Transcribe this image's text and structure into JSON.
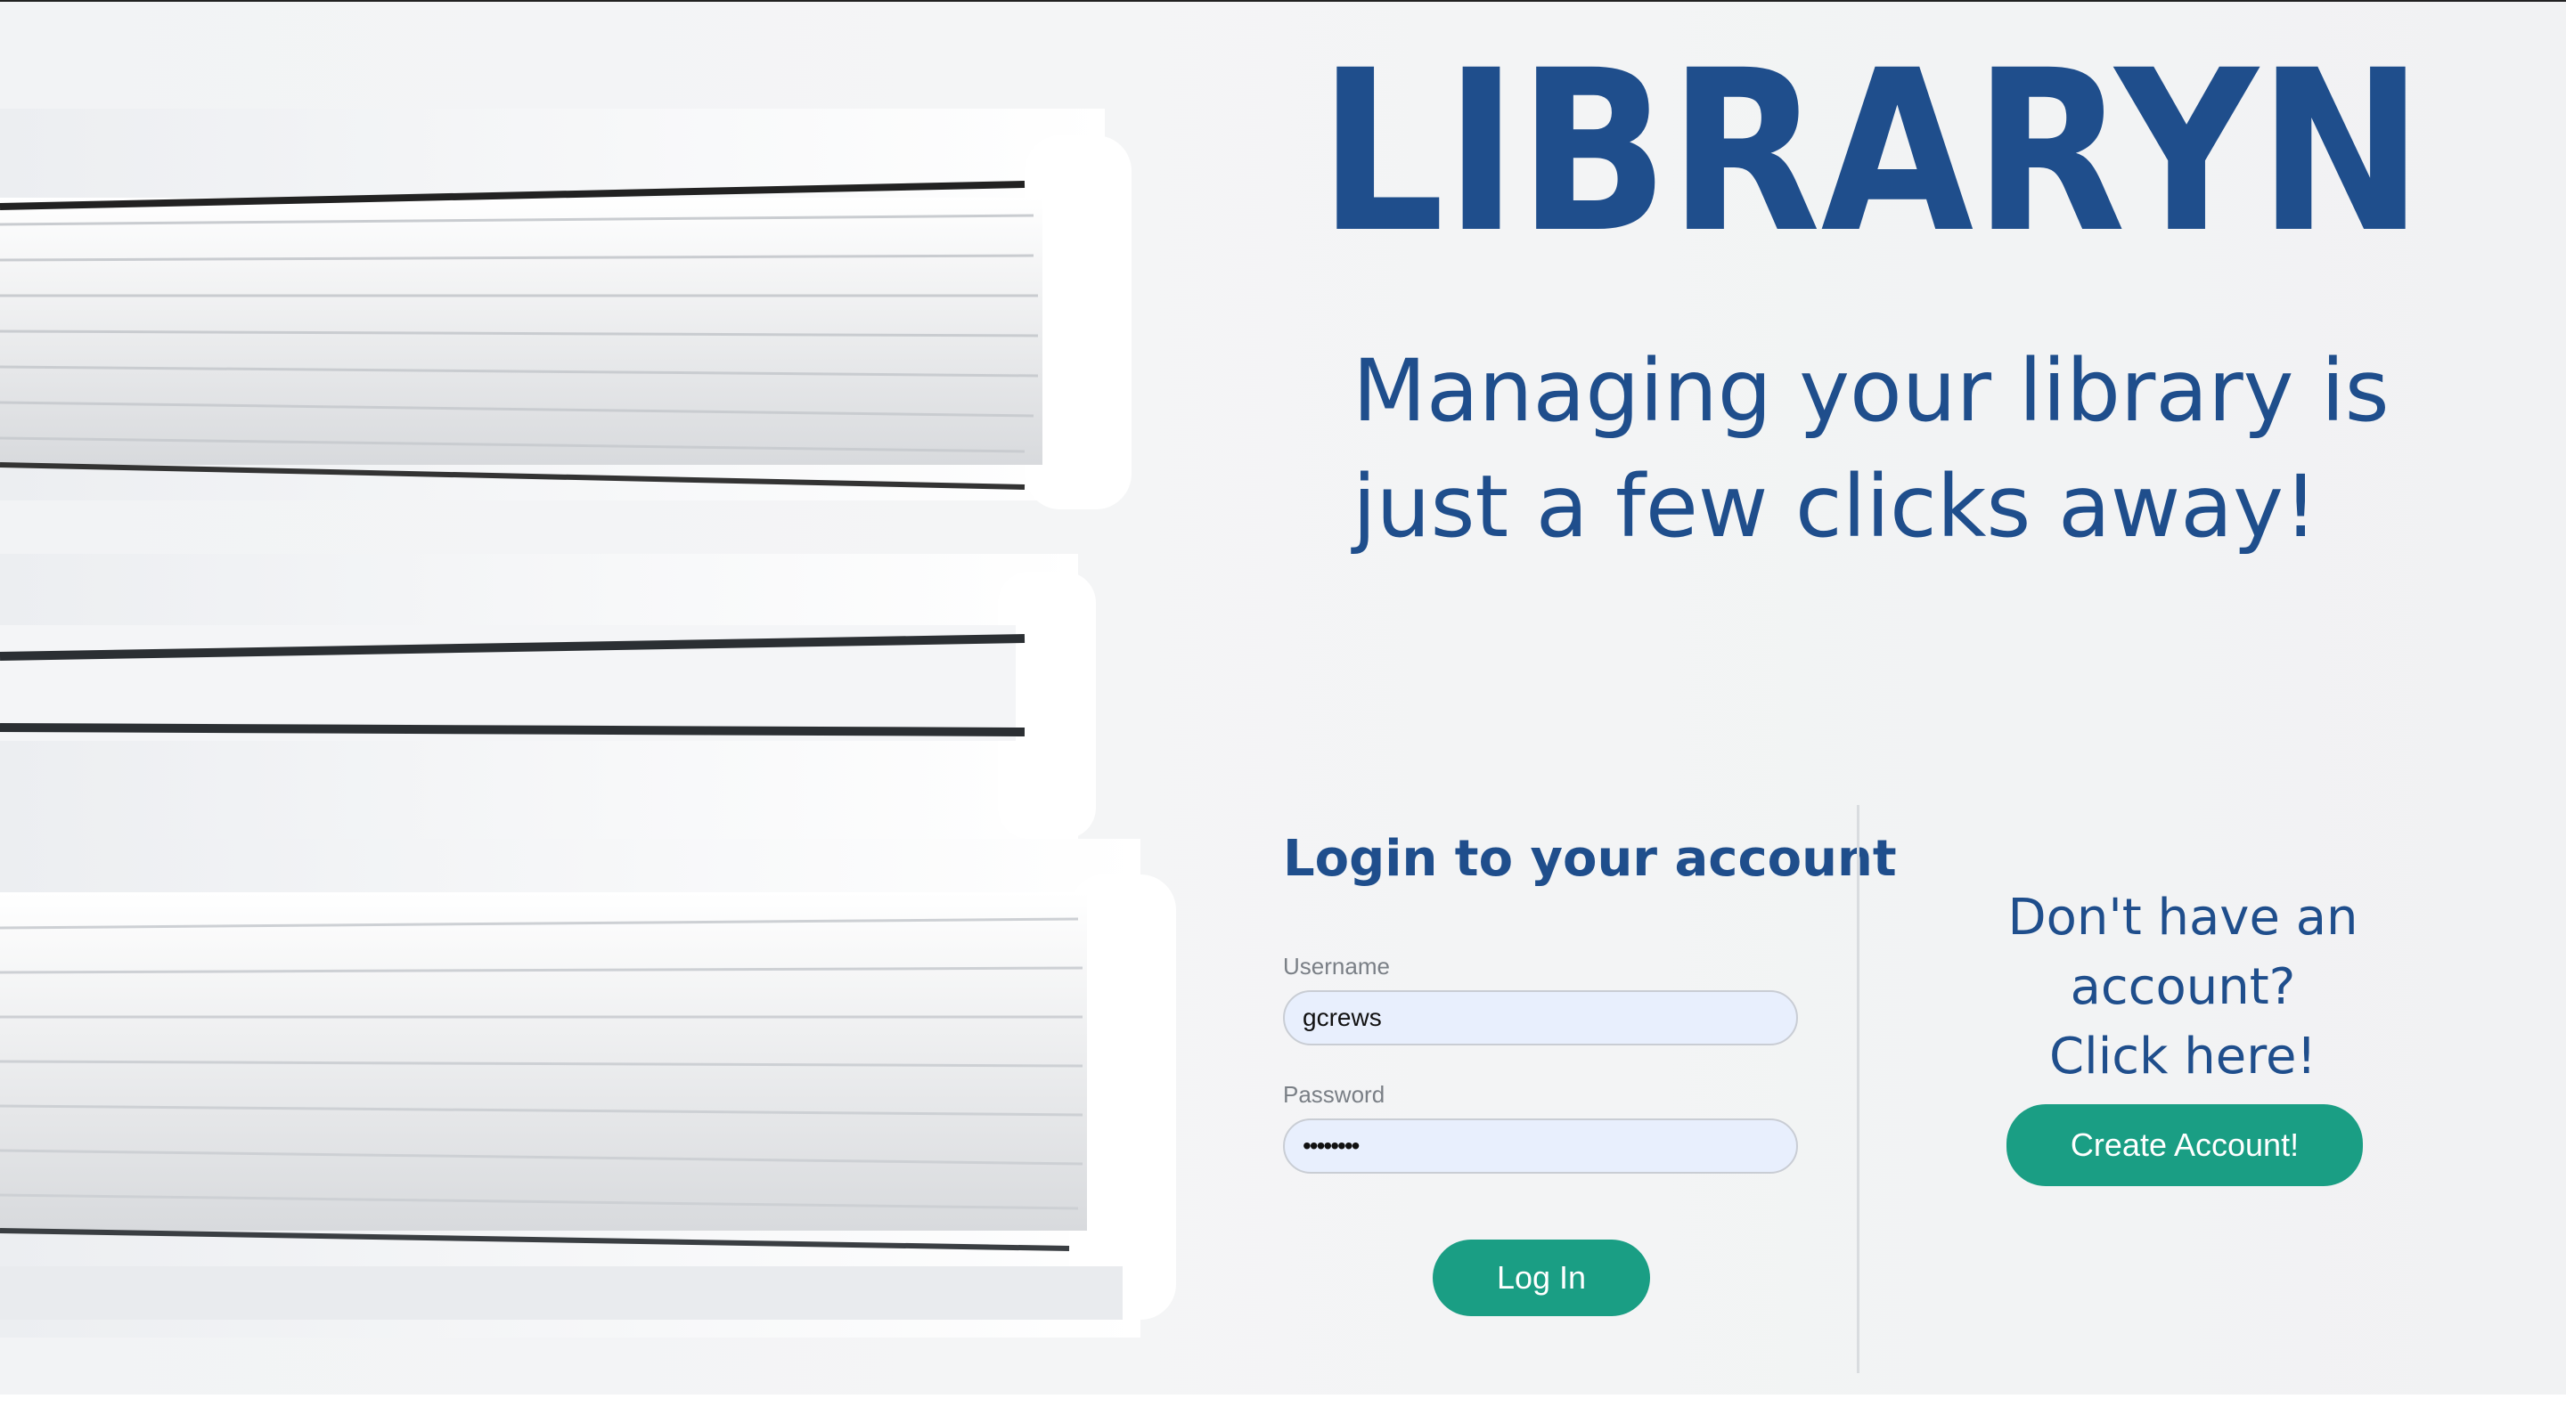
{
  "brand": {
    "logo_text": "LIBRARYN",
    "logo_color": "#1f4e8c"
  },
  "hero": {
    "tagline_line1": "Managing your library is",
    "tagline_line2": "just a few clicks away!"
  },
  "login": {
    "heading": "Login to your account",
    "username_label": "Username",
    "username_value": "gcrews",
    "password_label": "Password",
    "password_value": "••••••••",
    "submit_label": "Log In"
  },
  "signup": {
    "heading_line1": "Don't have an account?",
    "heading_line2": "Click here!",
    "button_label": "Create Account!"
  },
  "colors": {
    "accent": "#1a9e84",
    "brand": "#1f4e8c",
    "input_bg": "#e8effd"
  }
}
